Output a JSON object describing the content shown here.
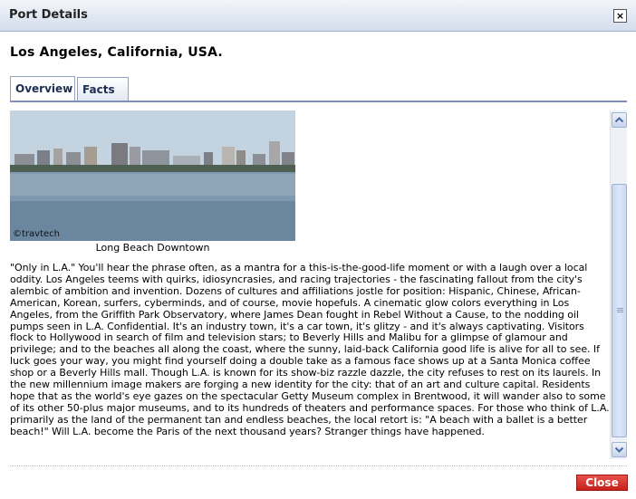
{
  "dialog": {
    "title": "Port Details",
    "close_icon": "×"
  },
  "port": {
    "name": "Los Angeles, California, USA."
  },
  "tabs": [
    {
      "label": "Overview",
      "active": true
    },
    {
      "label": "Facts",
      "active": false
    }
  ],
  "overview": {
    "photo_credit": "©travtech",
    "caption": "Long Beach Downtown",
    "text": "\"Only in L.A.\" You'll hear the phrase often, as a mantra for a this-is-the-good-life moment or with a laugh over a local oddity. Los Angeles teems with quirks, idiosyncrasies, and racing trajectories - the fascinating fallout from the city's alembic of ambition and invention. Dozens of cultures and affiliations jostle for position: Hispanic, Chinese, African-American, Korean, surfers, cyberminds, and of course, movie hopefuls. A cinematic glow colors everything in Los Angeles, from the Griffith Park Observatory, where James Dean fought in Rebel Without a Cause, to the nodding oil pumps seen in L.A. Confidential. It's an industry town, it's a car town, it's glitzy - and it's always captivating. Visitors flock to Hollywood in search of film and television stars; to Beverly Hills and Malibu for a glimpse of glamour and privilege; and to the beaches all along the coast, where the sunny, laid-back California good life is alive for all to see. If luck goes your way, you might find yourself doing a double take as a famous face shows up at a Santa Monica coffee shop or a Beverly Hills mall. Though L.A. is known for its show-biz razzle dazzle, the city refuses to rest on its laurels. In the new millennium image makers are forging a new identity for the city: that of an art and culture capital. Residents hope that as the world's eye gazes on the spectacular Getty Museum complex in Brentwood, it will wander also to some of its other 50-plus major museums, and to its hundreds of theaters and performance spaces. For those who think of L.A. primarily as the land of the permanent tan and endless beaches, the local retort is: \"A beach with a ballet is a better beach!\" Will L.A. become the Paris of the next thousand years? Stranger things have happened."
  },
  "footer": {
    "close_label": "Close"
  },
  "colors": {
    "close_button": "#d2322d",
    "tab_border": "#7d93bb"
  }
}
